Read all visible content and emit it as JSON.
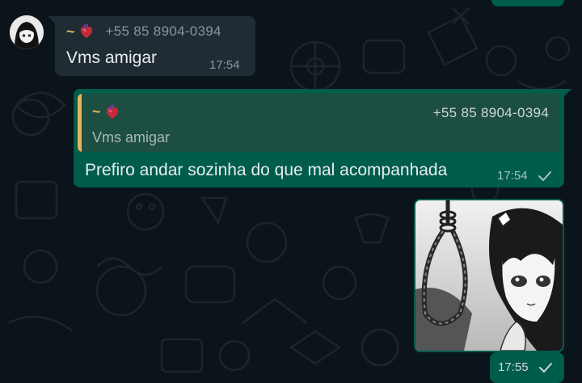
{
  "chat": {
    "incoming_message": {
      "sender_prefix": "~",
      "sender_phone": "+55 85 8904-0394",
      "text": "Vms amigar",
      "time": "17:54"
    },
    "outgoing_reply": {
      "quote": {
        "author_prefix": "~",
        "author_phone": "+55 85 8904-0394",
        "text": "Vms amigar"
      },
      "text": "Prefiro andar sozinha do que mal acompanhada",
      "time": "17:54",
      "status": "sent-check"
    },
    "outgoing_image": {
      "time": "17:55",
      "status": "sent-check"
    }
  },
  "colors": {
    "background": "#0b141a",
    "incoming_bubble": "#202c33",
    "outgoing_bubble": "#005c4b",
    "quote_bar": "#e9b25f",
    "secondary_text": "#8696a0"
  },
  "icons": {
    "sender_emoji": "anatomical-heart-icon",
    "message_status": "check-icon"
  }
}
